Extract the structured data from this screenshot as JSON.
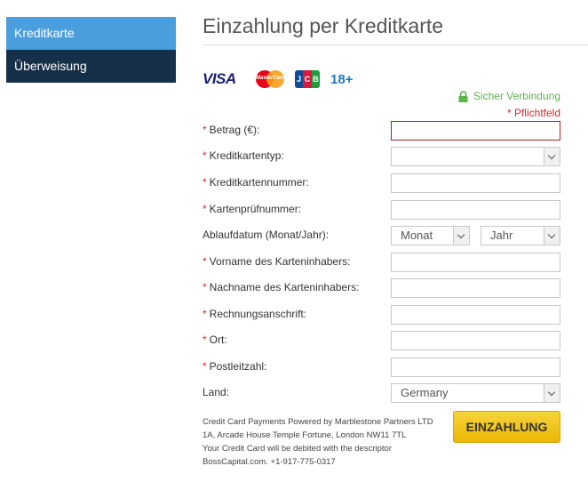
{
  "sidebar": {
    "items": [
      {
        "label": "Kreditkarte",
        "active": true
      },
      {
        "label": "Überweisung",
        "active": false
      }
    ]
  },
  "page": {
    "title": "Einzahlung per Kreditkarte"
  },
  "cards": {
    "visa": "VISA",
    "mastercard": "MasterCard",
    "jcb": [
      "J",
      "C",
      "B"
    ],
    "age": "18+"
  },
  "security": {
    "secure_text": "Sicher Verbindung",
    "required_note": "* Pflichtfeld"
  },
  "form": {
    "amount_label": "Betrag (€):",
    "card_type_label": "Kreditkartentyp:",
    "card_number_label": "Kreditkartennummer:",
    "cvv_label": "Kartenprüfnummer:",
    "expiry_label": "Ablaufdatum (Monat/Jahr):",
    "month_value": "Monat",
    "year_value": "Jahr",
    "first_name_label": "Vorname des Karteninhabers:",
    "last_name_label": "Nachname des Karteninhabers:",
    "address_label": "Rechnungsanschrift:",
    "city_label": "Ort:",
    "zip_label": "Postleitzahl:",
    "country_label": "Land:",
    "country_value": "Germany",
    "required_marker": "*"
  },
  "footer": {
    "lines": [
      "Credit Card Payments Powered by Marblestone Partners LTD",
      "1A, Arcade House Temple Fortune, London NW11 7TL",
      "Your Credit Card will be debited with the descriptor",
      "BossCapital.com. +1-917-775-0317"
    ],
    "submit_label": "EINZAHLUNG"
  },
  "colors": {
    "sidebar_active": "#4a9edb",
    "sidebar_inactive": "#17304a",
    "required": "#cc2a2a",
    "secure": "#5ab54a",
    "button": "#f5c518"
  },
  "icons": [
    "lock-icon",
    "chevron-down-icon"
  ]
}
